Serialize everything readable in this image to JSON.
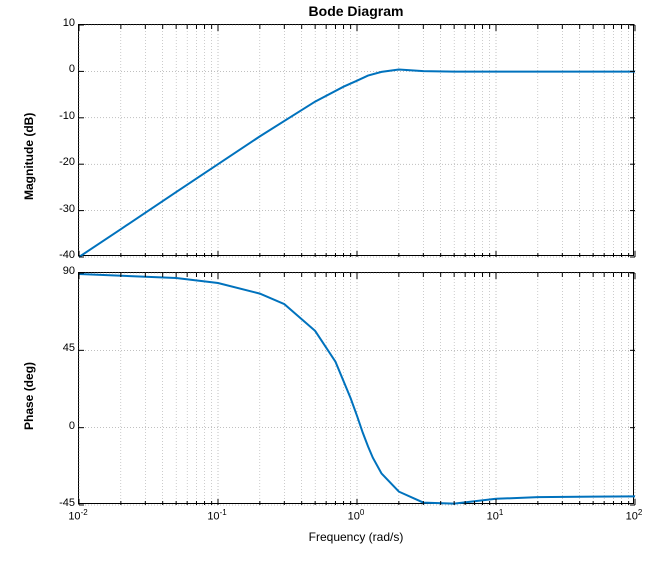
{
  "chart_data": [
    {
      "type": "line",
      "title": "Bode Diagram",
      "ylabel": "Magnitude (dB)",
      "xscale": "log",
      "xrange": [
        0.01,
        100
      ],
      "yrange": [
        -40,
        10
      ],
      "yticks": [
        -40,
        -30,
        -20,
        -10,
        0,
        10
      ],
      "x": [
        0.01,
        0.02,
        0.05,
        0.1,
        0.2,
        0.5,
        0.8,
        1.0,
        1.2,
        1.5,
        2.0,
        3.0,
        5.0,
        10.0,
        20.0,
        50.0,
        100.0
      ],
      "y": [
        -40,
        -34,
        -26,
        -20,
        -14,
        -6.5,
        -3.3,
        -2.0,
        -0.9,
        -0.1,
        0.4,
        0.05,
        -0.04,
        -0.04,
        -0.04,
        -0.04,
        -0.04
      ],
      "series_name": "Magnitude"
    },
    {
      "type": "line",
      "ylabel": "Phase (deg)",
      "xlabel": "Frequency  (rad/s)",
      "xscale": "log",
      "xrange": [
        0.01,
        100
      ],
      "yrange": [
        -45,
        90
      ],
      "yticks": [
        -45,
        0,
        45,
        90
      ],
      "xtick_labels": [
        "10^-2",
        "10^-1",
        "10^0",
        "10^1",
        "10^2"
      ],
      "x": [
        0.01,
        0.05,
        0.1,
        0.2,
        0.3,
        0.5,
        0.7,
        0.9,
        1.0,
        1.1,
        1.2,
        1.3,
        1.5,
        2.0,
        3.0,
        5.0,
        10.0,
        20.0,
        50.0,
        100.0
      ],
      "y": [
        89.4,
        87.1,
        84.2,
        78.0,
        71.9,
        56.3,
        38.4,
        17.1,
        6.9,
        -2.9,
        -10.9,
        -17.5,
        -26.6,
        -37.2,
        -43.6,
        -44.2,
        -41.4,
        -40.4,
        -40.1,
        -40.0
      ],
      "series_name": "Phase"
    }
  ],
  "title": "Bode Diagram",
  "mag": {
    "ylabel": "Magnitude (dB)",
    "yticks": [
      "-40",
      "-30",
      "-20",
      "-10",
      "0",
      "10"
    ]
  },
  "phase": {
    "ylabel": "Phase (deg)",
    "yticks": [
      "-45",
      "0",
      "45",
      "90"
    ]
  },
  "xlabel": "Frequency  (rad/s)",
  "xticks": {
    "base": "10",
    "exps": [
      "-2",
      "-1",
      "0",
      "1",
      "2"
    ]
  }
}
